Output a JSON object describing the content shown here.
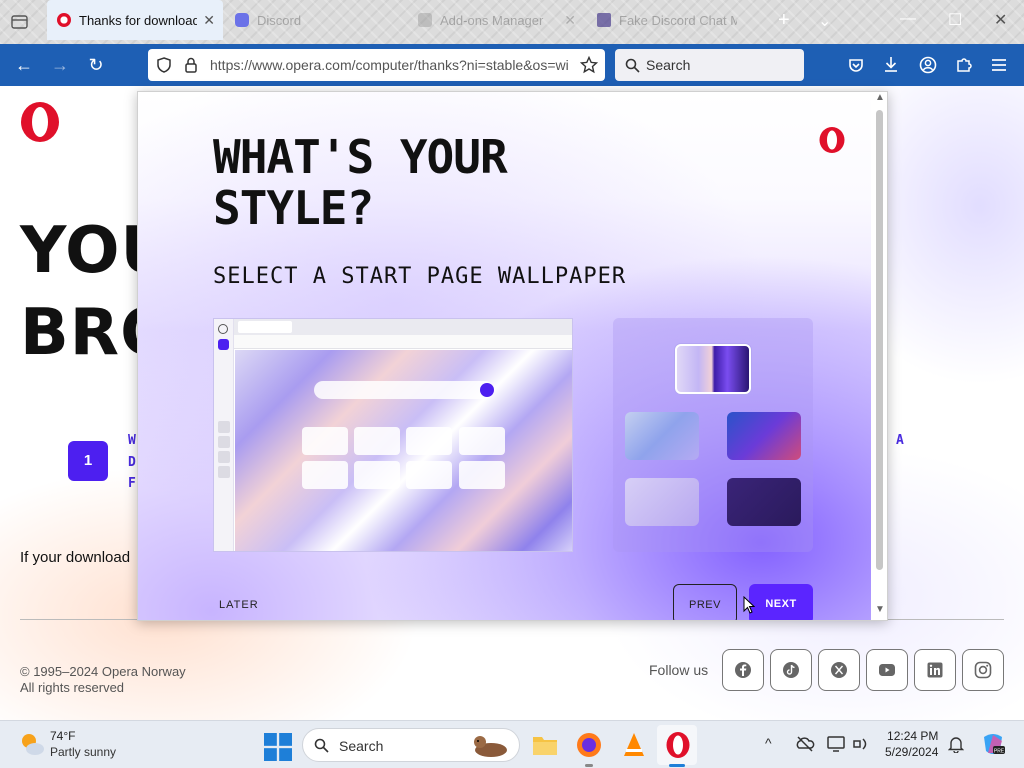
{
  "browser": {
    "tabs": [
      {
        "title": "Thanks for downloading",
        "active": true
      },
      {
        "title": "Discord",
        "active": false
      },
      {
        "title": "Add-ons Manager",
        "active": false
      },
      {
        "title": "Fake Discord Chat M",
        "active": false
      }
    ],
    "url": "https://www.opera.com/computer/thanks?ni=stable&os=wi",
    "url_domain": "opera.com",
    "search_placeholder": "Search"
  },
  "page": {
    "headline_line1": "YOU",
    "headline_line2": "BRO",
    "step_number": "1",
    "step_letters": [
      "W",
      "D",
      "F"
    ],
    "right_letter": "A",
    "download_text": "If your download",
    "copyright_line1": "© 1995–2024 Opera Norway",
    "copyright_line2": "All rights reserved",
    "follow_us": "Follow us",
    "social_icons": [
      "facebook-icon",
      "tiktok-icon",
      "x-icon",
      "youtube-icon",
      "linkedin-icon",
      "instagram-icon"
    ]
  },
  "modal": {
    "title": "WHAT'S YOUR STYLE?",
    "subtitle": "SELECT A START PAGE WALLPAPER",
    "later_label": "LATER",
    "prev_label": "PREV",
    "next_label": "NEXT",
    "wallpaper_options_count": 5,
    "selected_wallpaper": 1,
    "accent_color": "#5b25ff"
  },
  "taskbar": {
    "weather_temp": "74°F",
    "weather_desc": "Partly sunny",
    "search_placeholder": "Search",
    "time": "12:24 PM",
    "date": "5/29/2024"
  }
}
